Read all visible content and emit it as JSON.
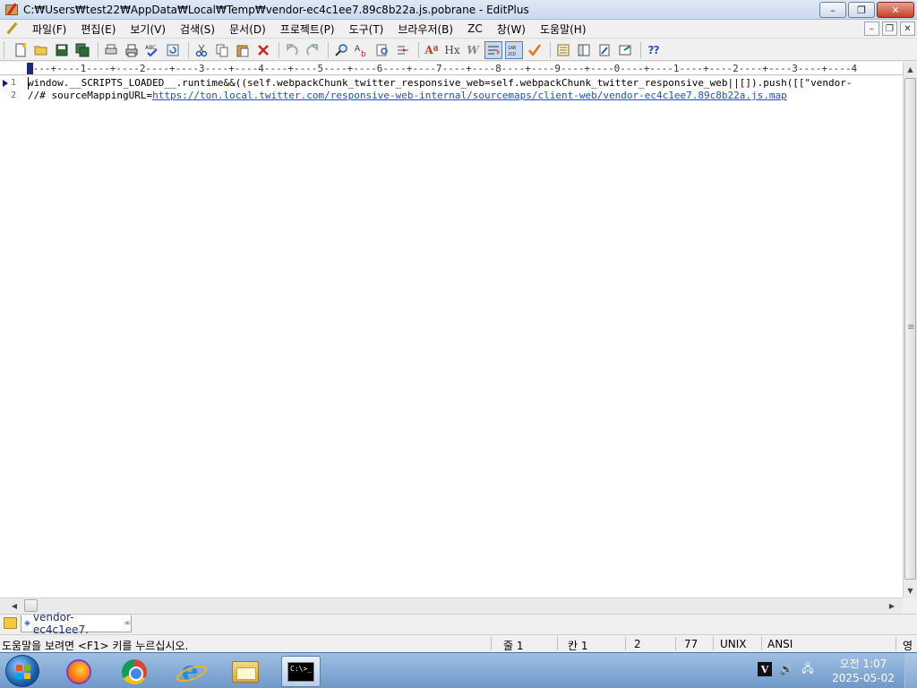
{
  "window": {
    "title": "C:₩Users₩test22₩AppData₩Local₩Temp₩vendor-ec4c1ee7.89c8b22a.js.pobrane - EditPlus",
    "minimize": "–",
    "restore": "❐",
    "close": "✕"
  },
  "menu": {
    "items": [
      "파일(F)",
      "편집(E)",
      "보기(V)",
      "검색(S)",
      "문서(D)",
      "프로젝트(P)",
      "도구(T)",
      "브라우저(B)",
      "ZC",
      "창(W)",
      "도움말(H)"
    ],
    "mdi_minimize": "–",
    "mdi_restore": "❐",
    "mdi_close": "✕"
  },
  "toolbar": {
    "icons": [
      "new-file-icon",
      "open-icon",
      "save-icon",
      "save-all-icon",
      "print-preview-icon",
      "print-icon",
      "spell-check-icon",
      "reload-icon",
      "cut-icon",
      "copy-icon",
      "paste-icon",
      "delete-icon",
      "undo-icon",
      "redo-icon",
      "find-icon",
      "replace-icon",
      "find-in-files-icon",
      "goto-icon",
      "font-icon",
      "html-tag-icon",
      "word-wrap-icon",
      "line-wrap-icon",
      "column-icon",
      "check-icon",
      "window-list-icon",
      "output-window-icon",
      "cliptext-icon",
      "browser-icon",
      "context-help-icon"
    ],
    "glyph_font": "Aª",
    "glyph_hx": "Hx",
    "glyph_w": "W",
    "glyph_help": "⁇"
  },
  "ruler": {
    "text": "----+----1----+----2----+----3----+----4----+----5----+----6----+----7----+----8----+----9----+----0----+----1----+----2----+----3----+----4"
  },
  "editor": {
    "lines": [
      {
        "number": "1",
        "text": "window.__SCRIPTS_LOADED__.runtime&&((self.webpackChunk_twitter_responsive_web=self.webpackChunk_twitter_responsive_web||[]).push([[\"vendor-"
      },
      {
        "number": "2",
        "prefix": "//# sourceMappingURL=",
        "url": "https://ton.local.twitter.com/responsive-web-internal/sourcemaps/client-web/vendor-ec4c1ee7.89c8b22a.js.map"
      }
    ]
  },
  "tabs": {
    "active": "vendor-ec4c1ee7.",
    "close": "∞"
  },
  "status": {
    "help": "도움말을 보려면 <F1> 키를 누르십시오.",
    "line": "줄 1",
    "column": "칸 1",
    "lines_count": "2",
    "size": "77",
    "line_ending": "UNIX",
    "encoding": "ANSI",
    "mode": "영"
  },
  "taskbar": {
    "apps": [
      "firefox",
      "chrome",
      "internet-explorer",
      "file-explorer",
      "command-prompt"
    ],
    "cmd_label": "C:\\>_",
    "ie_glyph": "e",
    "clock_time": "오전 1:07",
    "clock_date": "2025-05-02",
    "tray_v": "V",
    "tray_volume": "🔊",
    "tray_network": "🖧"
  }
}
